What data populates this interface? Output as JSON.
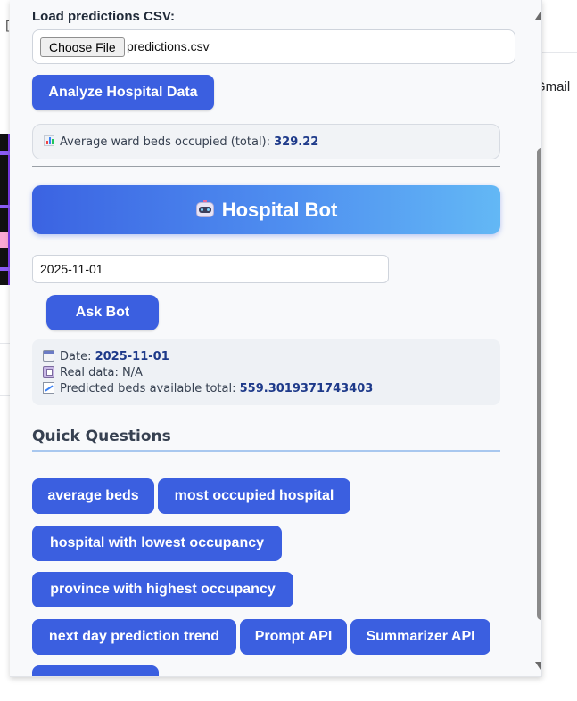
{
  "background": {
    "gmail_label": "Gmail",
    "bracket_char": "["
  },
  "loader": {
    "label": "Load predictions CSV:",
    "choose_file_label": "Choose File",
    "file_name": "predictions.csv",
    "analyze_button": "Analyze Hospital Data"
  },
  "average": {
    "icon": "bar-chart-icon",
    "label": "Average ward beds occupied (total): ",
    "value": "329.22"
  },
  "bot": {
    "icon": "robot-icon",
    "title": "Hospital Bot",
    "date_value": "2025-11-01",
    "ask_button": "Ask Bot"
  },
  "result": {
    "date_label": "Date: ",
    "date_value": "2025-11-01",
    "real_label": "Real data: N/A",
    "predicted_label": "Predicted beds available total: ",
    "predicted_value": "559.3019371743403"
  },
  "quick_questions": {
    "title": "Quick Questions",
    "buttons": [
      "average beds",
      "most occupied hospital",
      "hospital with lowest occupancy",
      "province with highest occupancy",
      "next day prediction trend",
      "Prompt API",
      "Summarizer API",
      ""
    ]
  },
  "colors": {
    "primary_button": "#3b5fe0",
    "value_text": "#1e3a8a",
    "banner_start": "#3b63e2",
    "banner_end": "#63b8f5"
  }
}
